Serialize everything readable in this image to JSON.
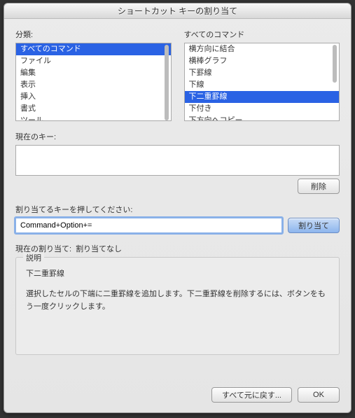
{
  "window": {
    "title": "ショートカット キーの割り当て"
  },
  "categories": {
    "label": "分類:",
    "items": [
      "すべてのコマンド",
      "ファイル",
      "編集",
      "表示",
      "挿入",
      "書式",
      "ツール"
    ],
    "selected_index": 0
  },
  "commands": {
    "label": "すべてのコマンド",
    "items": [
      "横方向に結合",
      "横棒グラフ",
      "下罫線",
      "下線",
      "下二重罫線",
      "下付き",
      "下方向へコピー"
    ],
    "selected_index": 4
  },
  "current_key": {
    "label": "現在のキー:",
    "value": ""
  },
  "delete_button": "削除",
  "assign": {
    "label": "割り当てるキーを押してください:",
    "value": "Command+Option+=",
    "button": "割り当て"
  },
  "current_assignment": {
    "label": "現在の割り当て:",
    "value": "割り当てなし"
  },
  "description": {
    "label": "説明",
    "command": "下二重罫線",
    "text": "選択したセルの下端に二重罫線を追加します。下二重罫線を削除するには、ボタンをもう一度クリックします。"
  },
  "footer": {
    "reset": "すべて元に戻す...",
    "ok": "OK"
  }
}
